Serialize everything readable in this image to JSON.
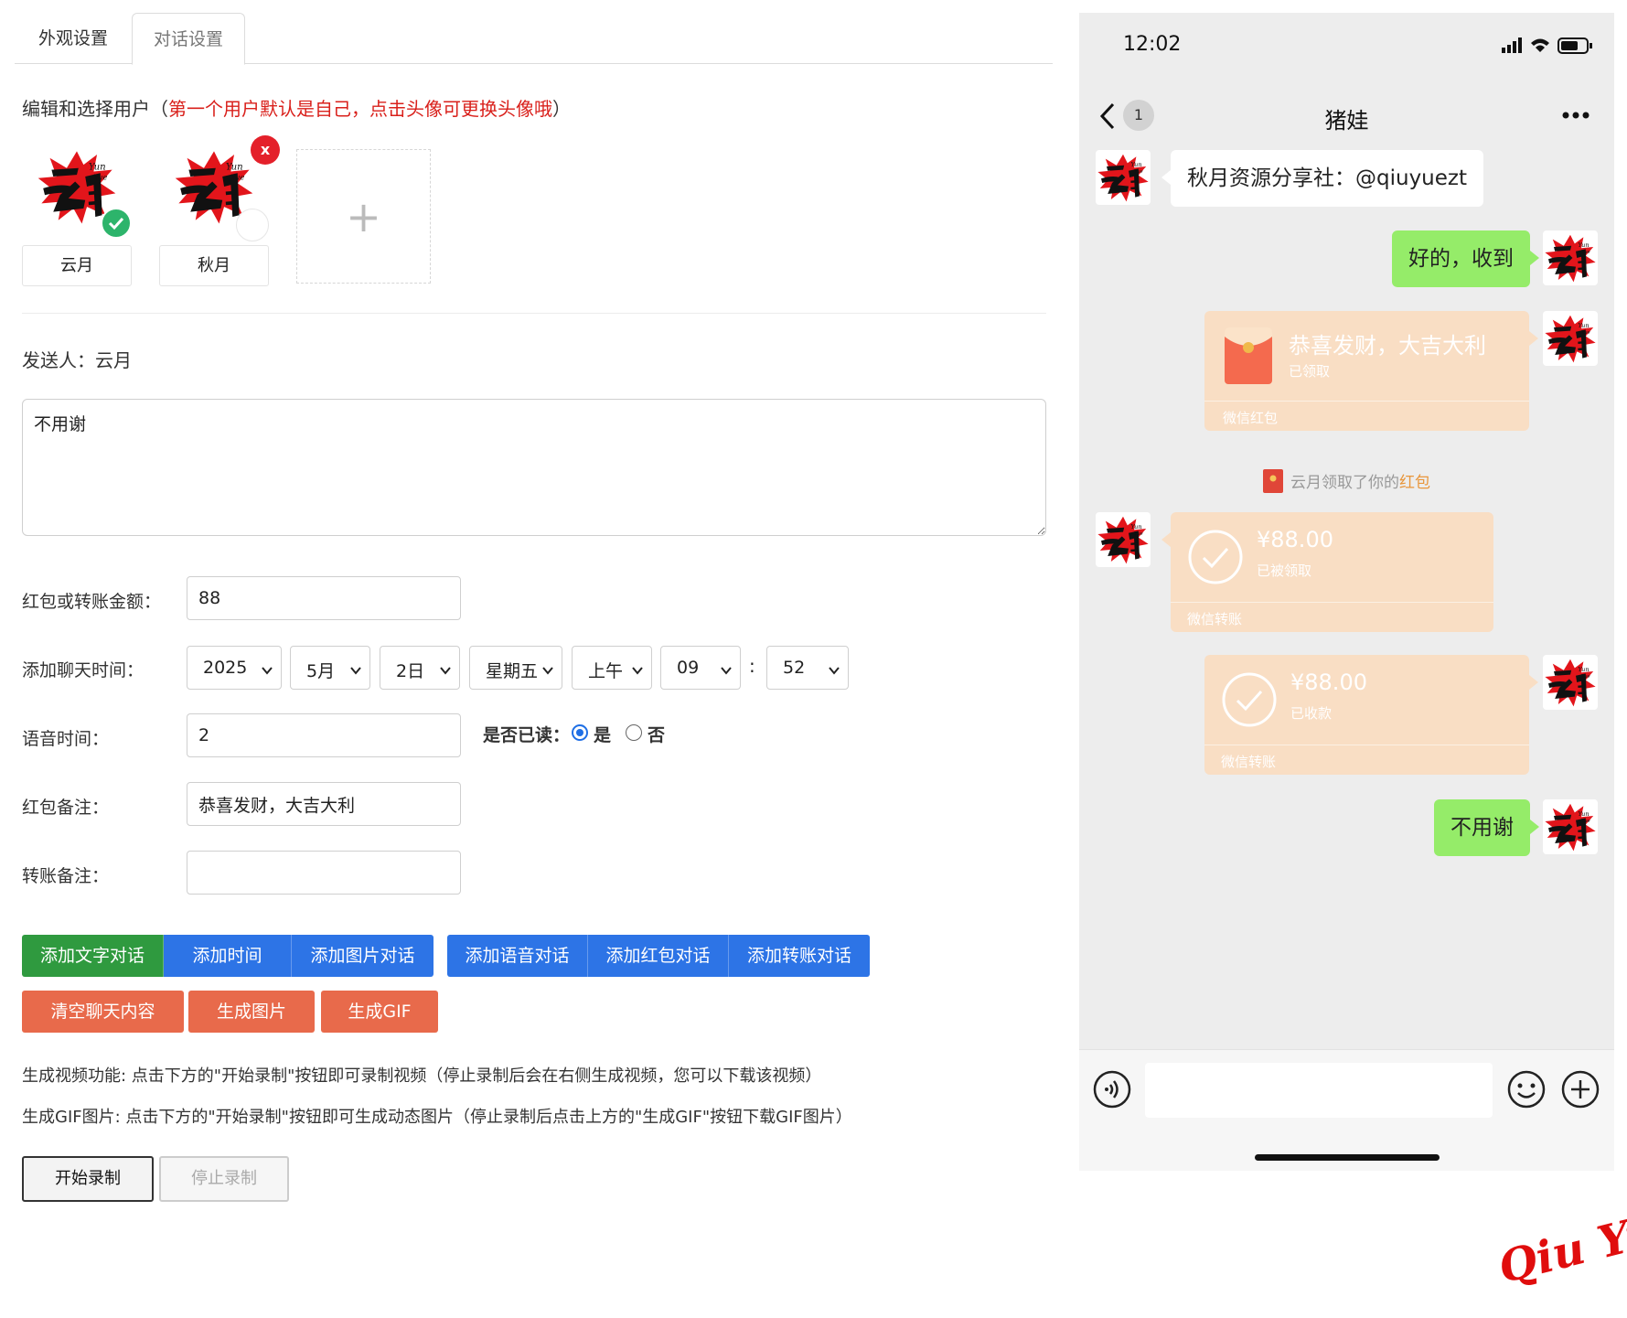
{
  "tabs": [
    {
      "label": "外观设置",
      "active": false
    },
    {
      "label": "对话设置",
      "active": true
    }
  ],
  "user_section": {
    "prefix": "编辑和选择用户（",
    "note": "第一个用户默认是自己，点击头像可更换头像哦",
    "suffix": "）",
    "users": [
      {
        "name": "云月",
        "selected": true
      },
      {
        "name": "秋月",
        "selected": false,
        "deletable": true
      }
    ],
    "delete_symbol": "x",
    "add_symbol": "+"
  },
  "sender": {
    "label": "发送人：",
    "name": "云月"
  },
  "message_text": "不用谢",
  "form": {
    "amount_label": "红包或转账金额：",
    "amount_value": "88",
    "time_label": "添加聊天时间：",
    "time": {
      "year": "2025",
      "month": "5月",
      "day": "2日",
      "weekday": "星期五",
      "ampm": "上午",
      "hour": "09",
      "separator": ":",
      "minute": "52"
    },
    "voice_label": "语音时间：",
    "voice_value": "2",
    "read_label": "是否已读：",
    "read_yes": "是",
    "read_no": "否",
    "read_selected": "是",
    "hongbao_note_label": "红包备注：",
    "hongbao_note_value": "恭喜发财，大吉大利",
    "transfer_note_label": "转账备注：",
    "transfer_note_value": ""
  },
  "buttons": {
    "add_text": "添加文字对话",
    "add_time": "添加时间",
    "add_image": "添加图片对话",
    "add_voice": "添加语音对话",
    "add_hongbao": "添加红包对话",
    "add_transfer": "添加转账对话",
    "clear": "清空聊天内容",
    "gen_image": "生成图片",
    "gen_gif": "生成GIF"
  },
  "info": {
    "video": "生成视频功能: 点击下方的\"开始录制\"按钮即可录制视频（停止录制后会在右侧生成视频，您可以下载该视频）",
    "gif": "生成GIF图片: 点击下方的\"开始录制\"按钮即可生成动态图片（停止录制后点击上方的\"生成GIF\"按钮下载GIF图片）"
  },
  "record": {
    "start": "开始录制",
    "stop": "停止录制"
  },
  "phone": {
    "time": "12:02",
    "back_count": "1",
    "title": "猪娃",
    "messages": {
      "m1": "秋月资源分享社：@qiuyuezt",
      "m2": "好的，收到",
      "hongbao_title": "恭喜发财，大吉大利",
      "hongbao_status": "已领取",
      "hongbao_footer": "微信红包",
      "sys_prefix": "云月领取了你的",
      "sys_hongbao": "红包",
      "transfer1_amount": "¥88.00",
      "transfer1_status": "已被领取",
      "transfer1_footer": "微信转账",
      "transfer2_amount": "¥88.00",
      "transfer2_status": "已收款",
      "transfer2_footer": "微信转账",
      "m_last": "不用谢"
    }
  },
  "watermark": "Qiu Yue",
  "colors": {
    "tab_border": "#dcdcdc",
    "note_red": "#d9201b",
    "btn_green": "#2f9a3f",
    "btn_blue": "#2d74e6",
    "btn_orange": "#e86a4b",
    "bubble_green": "#95ec69",
    "card_peach": "#f9dec4",
    "chat_bg": "#ededed",
    "check_green": "#2db46b",
    "delete_red": "#e4202a"
  }
}
